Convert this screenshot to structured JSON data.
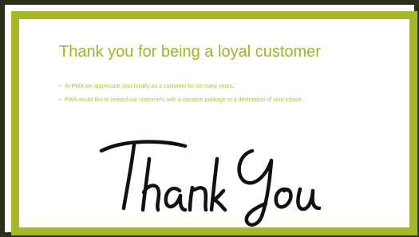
{
  "slide": {
    "title": "Thank you for being a loyal customer",
    "bullets": [
      "At PWA we appreciate your loyalty as a customer for so many years.",
      "PWA would like to reward our customers with a vacation package to a destination of your choice."
    ],
    "image_text": "Thank You"
  },
  "colors": {
    "accent": "#a7b825",
    "title": "#a3b321",
    "outer_border": "#2c2f1a",
    "script_text": "#111111"
  }
}
